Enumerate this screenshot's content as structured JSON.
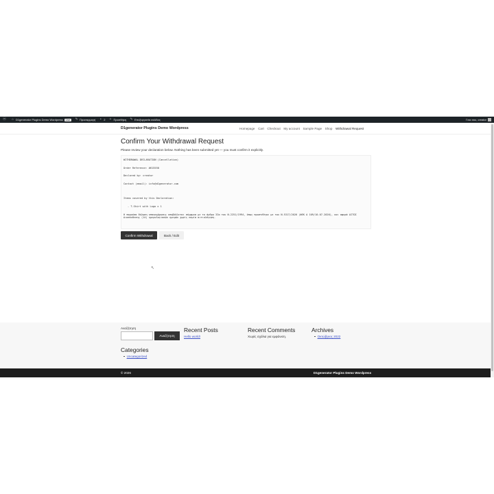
{
  "adminbar": {
    "site_name": "D1generator Plugins Demo Wordpress",
    "site_badge": "Live",
    "customize": "Προσαρμογή",
    "comments_count": "2",
    "new_label": "Προσθήκη",
    "edit_page": "Επεξεργασία σελίδας",
    "greeting": "Γεια σου, creator"
  },
  "header": {
    "site_title": "D1generator Plugins Demo Wordpress",
    "nav": [
      "Homepage",
      "Cart",
      "Checkout",
      "My account",
      "Sample Page",
      "Shop",
      "Withdrawal Request"
    ]
  },
  "main": {
    "title": "Confirm Your Withdrawal Request",
    "intro": "Please review your declaration below. Nothing has been submitted yet — you must confirm it explicitly.",
    "declaration": {
      "heading": "WITHDRAWAL DECLARATION (Cancellation)",
      "order_ref": "Order Reference: #615550",
      "declared_by": "Declared by: creator",
      "contact": "Contact (email): info@d1generator.com",
      "items_heading": "Items covered by this Declaration:",
      "item_1": "- T-Shirt with Logo x 1",
      "legal": "Η παρούσα δήλωση υπαναχώρησης υποβάλλεται σύμφωνα με το άρθρο 3Ια του Ν.2251/1994, όπως προστέθηκε με τον Ν.5317/2026 (ΦΕΚ Α 109/10-07-2026), και αφορά ΑΙΤΟΣ Διασύνδεσης (14) ημερολογιακών ημερών χωρίς καμία αιτιολόγηση."
    },
    "confirm_label": "Confirm Withdrawal",
    "back_label": "Back / Edit"
  },
  "footer_widgets": {
    "search_label": "Αναζήτηση",
    "search_button": "Αναζήτηση",
    "search_value": "",
    "recent_posts_title": "Recent Posts",
    "recent_posts": [
      "Hello world!"
    ],
    "recent_comments_title": "Recent Comments",
    "no_comments": "Χωρίς σχόλια για εμφάνιση.",
    "archives_title": "Archives",
    "archives": [
      "Οκτώβριος 2022"
    ],
    "categories_title": "Categories",
    "categories": [
      "Uncategorized"
    ]
  },
  "footer": {
    "copyright": "© 2026",
    "site_name": "D1generator Plugins Demo Wordpress"
  },
  "colors": {
    "adminbar_bg": "#1d2327",
    "primary_button": "#333333",
    "link": "#3b50c8",
    "footer_bg": "#1e1e1e"
  }
}
